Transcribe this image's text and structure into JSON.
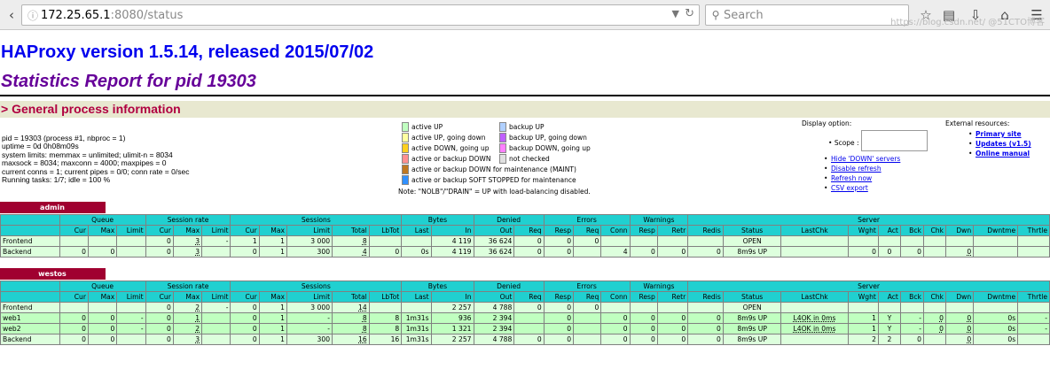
{
  "browser": {
    "url_host": "172.25.65.1",
    "url_rest": ":8080/status",
    "search_placeholder": "Search"
  },
  "header": {
    "title": "HAProxy version 1.5.14, released 2015/07/02",
    "subtitle": "Statistics Report for pid 19303"
  },
  "section": "> General process information",
  "info": [
    "pid = 19303 (process #1, nbproc = 1)",
    "uptime = 0d 0h08m09s",
    "system limits: memmax = unlimited; ulimit-n = 8034",
    "maxsock = 8034; maxconn = 4000; maxpipes = 0",
    "current conns = 1; current pipes = 0/0; conn rate = 0/sec",
    "Running tasks: 1/7; idle = 100 %"
  ],
  "legend": {
    "left": [
      {
        "label": "active UP",
        "color": "#c0ffc0"
      },
      {
        "label": "active UP, going down",
        "color": "#ffffa0"
      },
      {
        "label": "active DOWN, going up",
        "color": "#ffd020"
      },
      {
        "label": "active or backup DOWN",
        "color": "#ff9090"
      },
      {
        "label": "active or backup DOWN for maintenance (MAINT)",
        "color": "#c07820"
      },
      {
        "label": "active or backup SOFT STOPPED for maintenance",
        "color": "#3090ff"
      }
    ],
    "right": [
      {
        "label": "backup UP",
        "color": "#b0d0ff"
      },
      {
        "label": "backup UP, going down",
        "color": "#c060ff"
      },
      {
        "label": "backup DOWN, going up",
        "color": "#ff80ff"
      },
      {
        "label": "not checked",
        "color": "#e0e0e0"
      }
    ],
    "note": "Note: \"NOLB\"/\"DRAIN\" = UP with load-balancing disabled."
  },
  "display_options": {
    "title": "Display option:",
    "scope_label": "Scope :",
    "links": [
      "Hide 'DOWN' servers",
      "Disable refresh",
      "Refresh now",
      "CSV export"
    ]
  },
  "external": {
    "title": "External resources:",
    "links": [
      "Primary site",
      "Updates (v1.5)",
      "Online manual"
    ]
  },
  "headers_top": [
    "",
    "Queue",
    "Session rate",
    "Sessions",
    "Bytes",
    "Denied",
    "Errors",
    "Warnings",
    "Server"
  ],
  "headers_sub": [
    "",
    "Cur",
    "Max",
    "Limit",
    "Cur",
    "Max",
    "Limit",
    "Cur",
    "Max",
    "Limit",
    "Total",
    "LbTot",
    "Last",
    "In",
    "Out",
    "Req",
    "Resp",
    "Req",
    "Conn",
    "Resp",
    "Retr",
    "Redis",
    "Status",
    "LastChk",
    "Wght",
    "Act",
    "Bck",
    "Chk",
    "Dwn",
    "Dwntme",
    "Thrtle"
  ],
  "proxies": [
    {
      "name": "admin",
      "rows": [
        {
          "type": "fe",
          "cells": [
            "Frontend",
            "",
            "",
            "",
            "0",
            "3",
            "-",
            "1",
            "1",
            "3 000",
            "8",
            "",
            "",
            "4 119",
            "36 624",
            "0",
            "0",
            "0",
            "",
            "",
            "",
            "",
            "OPEN",
            "",
            "",
            "",
            "",
            "",
            "",
            "",
            ""
          ]
        },
        {
          "type": "be",
          "cells": [
            "Backend",
            "0",
            "0",
            "",
            "0",
            "3",
            "",
            "0",
            "1",
            "300",
            "4",
            "0",
            "0s",
            "4 119",
            "36 624",
            "0",
            "0",
            "",
            "4",
            "0",
            "0",
            "0",
            "8m9s UP",
            "",
            "0",
            "0",
            "0",
            "",
            "0",
            "",
            ""
          ]
        }
      ]
    },
    {
      "name": "westos",
      "rows": [
        {
          "type": "fe",
          "cells": [
            "Frontend",
            "",
            "",
            "",
            "0",
            "2",
            "-",
            "0",
            "1",
            "3 000",
            "14",
            "",
            "",
            "2 257",
            "4 788",
            "0",
            "0",
            "0",
            "",
            "",
            "",
            "",
            "OPEN",
            "",
            "",
            "",
            "",
            "",
            "",
            "",
            ""
          ]
        },
        {
          "type": "sv",
          "cells": [
            "web1",
            "0",
            "0",
            "-",
            "0",
            "1",
            "",
            "0",
            "1",
            "-",
            "8",
            "8",
            "1m31s",
            "936",
            "2 394",
            "",
            "0",
            "",
            "0",
            "0",
            "0",
            "0",
            "8m9s UP",
            "L4OK in 0ms",
            "1",
            "Y",
            "-",
            "0",
            "0",
            "0s",
            "-"
          ]
        },
        {
          "type": "sv",
          "cells": [
            "web2",
            "0",
            "0",
            "-",
            "0",
            "2",
            "",
            "0",
            "1",
            "-",
            "8",
            "8",
            "1m31s",
            "1 321",
            "2 394",
            "",
            "0",
            "",
            "0",
            "0",
            "0",
            "0",
            "8m9s UP",
            "L4OK in 0ms",
            "1",
            "Y",
            "-",
            "0",
            "0",
            "0s",
            "-"
          ]
        },
        {
          "type": "be",
          "cells": [
            "Backend",
            "0",
            "0",
            "",
            "0",
            "3",
            "",
            "0",
            "1",
            "300",
            "16",
            "16",
            "1m31s",
            "2 257",
            "4 788",
            "0",
            "0",
            "",
            "0",
            "0",
            "0",
            "0",
            "8m9s UP",
            "",
            "2",
            "2",
            "0",
            "",
            "0",
            "0s",
            ""
          ]
        }
      ]
    }
  ],
  "watermark": "https://blog.csdn.net/ @51CTO博客"
}
